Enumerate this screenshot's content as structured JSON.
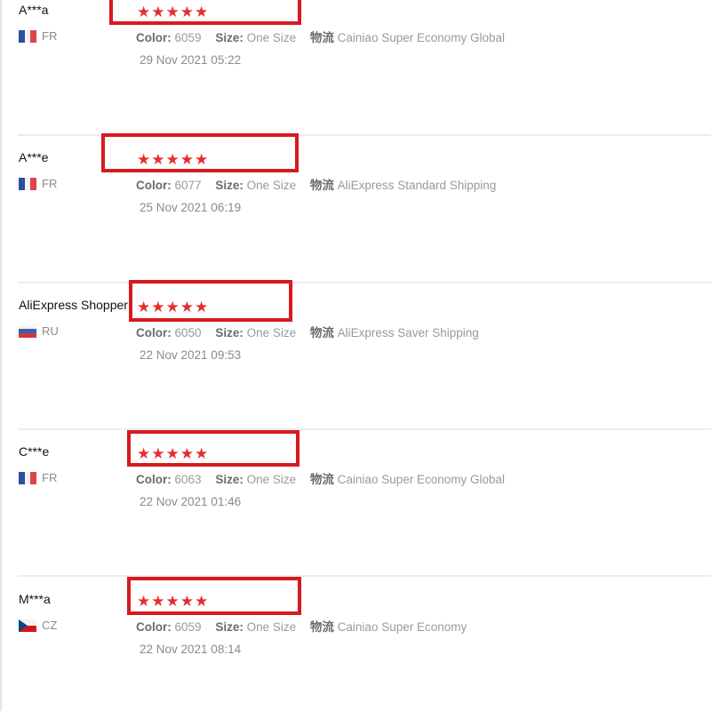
{
  "colors": {
    "star": "#e62e2e",
    "highlight_border": "#d71920",
    "divider": "#ececec",
    "meta_text": "#9a9a9a",
    "meta_label": "#6b6b6b"
  },
  "labels": {
    "color": "Color:",
    "size": "Size:",
    "logistics": "物流"
  },
  "reviews": [
    {
      "user": "A***a",
      "country": "FR",
      "flag_icon": "france-flag-icon",
      "rating": 5,
      "stars": "★★★★★",
      "color": "6059",
      "size": "One Size",
      "shipping": "Cainiao Super Economy Global",
      "date": "29 Nov 2021 05:22"
    },
    {
      "user": "A***e",
      "country": "FR",
      "flag_icon": "france-flag-icon",
      "rating": 5,
      "stars": "★★★★★",
      "color": "6077",
      "size": "One Size",
      "shipping": "AliExpress Standard Shipping",
      "date": "25 Nov 2021 06:19"
    },
    {
      "user": "AliExpress Shopper",
      "country": "RU",
      "flag_icon": "russia-flag-icon",
      "rating": 5,
      "stars": "★★★★★",
      "color": "6050",
      "size": "One Size",
      "shipping": "AliExpress Saver Shipping",
      "date": "22 Nov 2021 09:53"
    },
    {
      "user": "C***e",
      "country": "FR",
      "flag_icon": "france-flag-icon",
      "rating": 5,
      "stars": "★★★★★",
      "color": "6063",
      "size": "One Size",
      "shipping": "Cainiao Super Economy Global",
      "date": "22 Nov 2021 01:46"
    },
    {
      "user": "M***a",
      "country": "CZ",
      "flag_icon": "czech-flag-icon",
      "rating": 5,
      "stars": "★★★★★",
      "color": "6059",
      "size": "One Size",
      "shipping": "Cainiao Super Economy",
      "date": "22 Nov 2021 08:14"
    }
  ]
}
